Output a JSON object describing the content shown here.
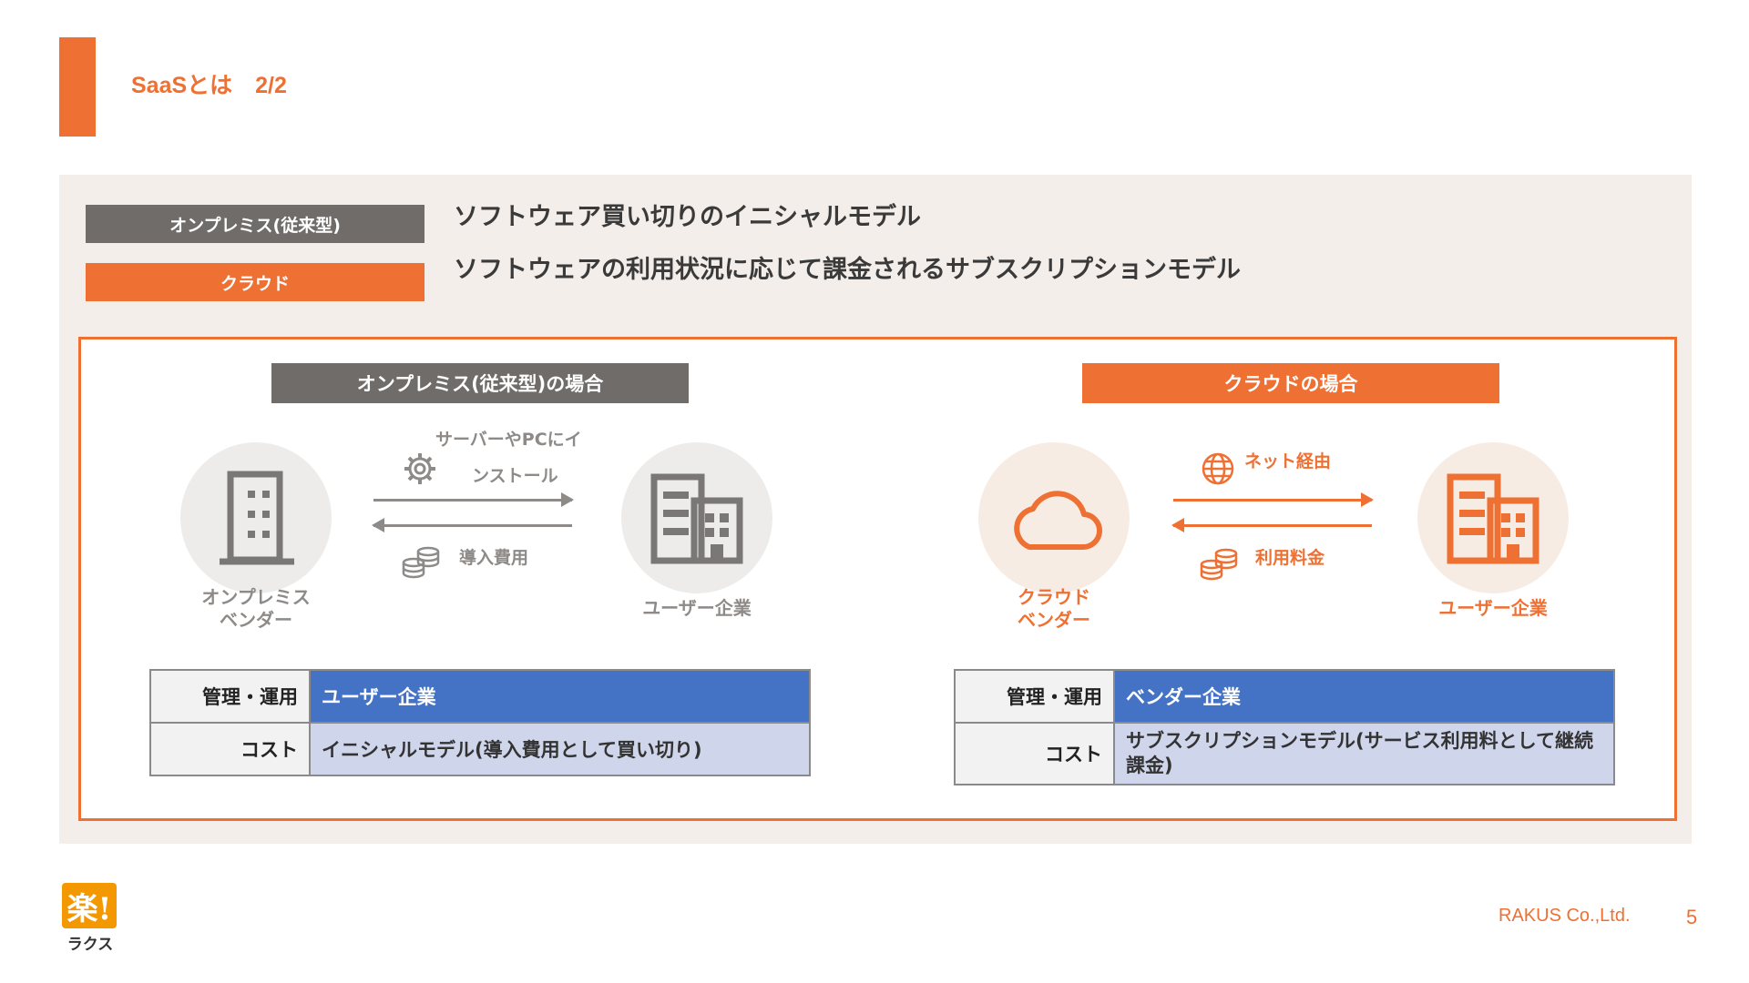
{
  "slide": {
    "title": "SaaSとは　2/2",
    "company": "RAKUS Co.,Ltd.",
    "page_number": "5"
  },
  "definitions": [
    {
      "tag": "オンプレミス(従来型)",
      "text": "ソフトウェア買い切りのイニシャルモデル"
    },
    {
      "tag": "クラウド",
      "text": "ソフトウェアの利用状況に応じて課金されるサブスクリプションモデル"
    }
  ],
  "onprem": {
    "heading": "オンプレミス(従来型)の場合",
    "vendor_label_line1": "オンプレミス",
    "vendor_label_line2": "ベンダー",
    "user_label": "ユーザー企業",
    "flow_top_line1": "サーバーやPCにイ",
    "flow_top_line2": "ンストール",
    "flow_bottom": "導入費用",
    "table": {
      "row1_key": "管理・運用",
      "row1_value": "ユーザー企業",
      "row2_key": "コスト",
      "row2_value": "イニシャルモデル(導入費用として買い切り)"
    }
  },
  "cloud": {
    "heading": "クラウドの場合",
    "vendor_label_line1": "クラウド",
    "vendor_label_line2": "ベンダー",
    "user_label": "ユーザー企業",
    "flow_top": "ネット経由",
    "flow_bottom": "利用料金",
    "table": {
      "row1_key": "管理・運用",
      "row1_value": "ベンダー企業",
      "row2_key": "コスト",
      "row2_value": "サブスクリプションモデル(サービス利用料として継続課金)"
    }
  },
  "logo": {
    "mark": "楽!",
    "sub": "ラクス"
  },
  "colors": {
    "accent": "#EE7033",
    "gray": "#706C6A",
    "table_blue": "#4472C4",
    "table_light": "#CFD5EA",
    "panel_bg": "#F3EEE9"
  },
  "icons": [
    "building-icon",
    "office-building-icon",
    "cloud-icon",
    "gear-icon",
    "coins-icon",
    "globe-icon"
  ]
}
